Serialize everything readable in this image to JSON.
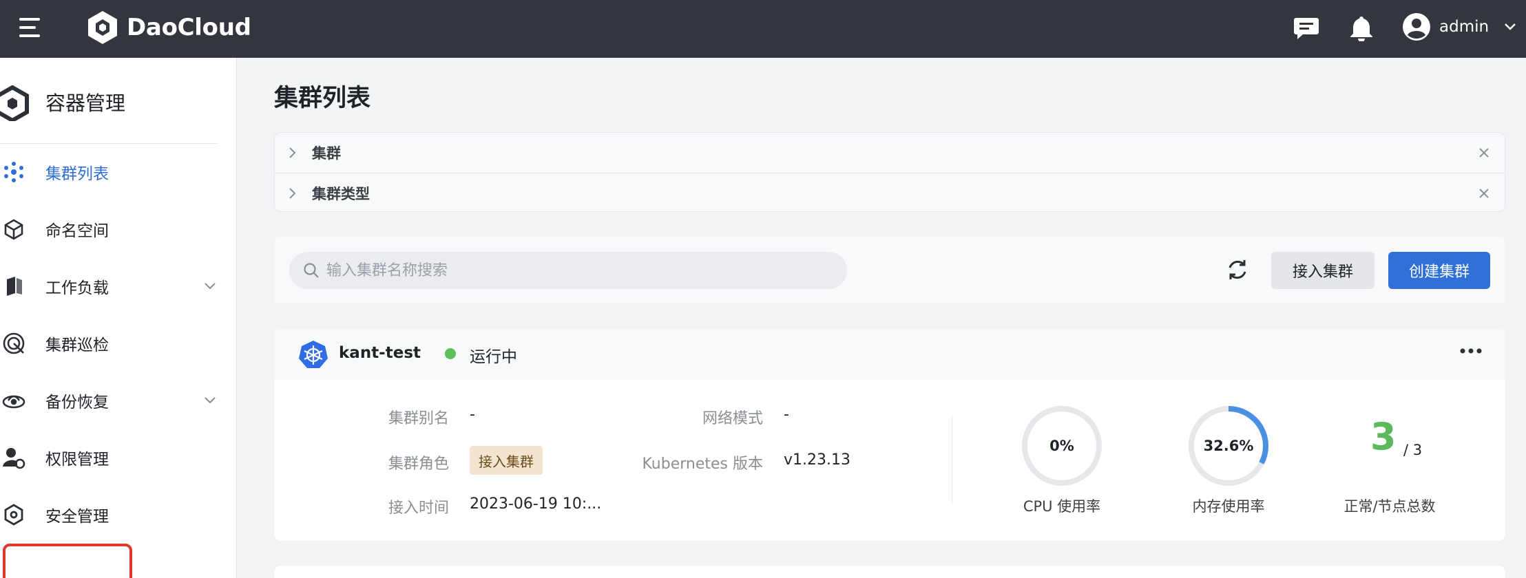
{
  "topbar": {
    "brand": "DaoCloud",
    "icons": [
      "hamburger-icon",
      "message-icon",
      "bell-icon",
      "user-avatar-icon",
      "chevron-down-icon"
    ],
    "username": "admin",
    "background": "#33363d"
  },
  "sidebar": {
    "title": "容器管理",
    "items": [
      {
        "label": "集群列表",
        "icon": "cluster-icon",
        "active": true
      },
      {
        "label": "命名空间",
        "icon": "namespace-icon"
      },
      {
        "label": "工作负载",
        "icon": "workload-icon",
        "expandable": true
      },
      {
        "label": "集群巡检",
        "icon": "inspection-icon"
      },
      {
        "label": "备份恢复",
        "icon": "backup-icon",
        "expandable": true
      },
      {
        "label": "权限管理",
        "icon": "permission-icon"
      },
      {
        "label": "安全管理",
        "icon": "security-icon",
        "highlighted": true
      }
    ]
  },
  "main": {
    "title": "集群列表",
    "filters": [
      "集群",
      "集群类型"
    ],
    "search": {
      "placeholder": "输入集群名称搜索",
      "value": ""
    },
    "buttons": {
      "connect": "接入集群",
      "create": "创建集群"
    },
    "cluster": {
      "name": "kant-test",
      "status": "运行中",
      "fields": {
        "alias_label": "集群别名",
        "alias_value": "-",
        "role_label": "集群角色",
        "role_value": "接入集群",
        "time_label": "接入时间",
        "time_value": "2023-06-19 10:...",
        "network_label": "网络模式",
        "network_value": "-",
        "k8s_label": "Kubernetes 版本",
        "k8s_value": "v1.23.13"
      },
      "metrics": {
        "cpu_value": "0%",
        "cpu_fraction": 0,
        "cpu_label": "CPU 使用率",
        "mem_value": "32.6%",
        "mem_fraction": 0.326,
        "mem_label": "内存使用率",
        "nodes_ok": "3",
        "nodes_total": "/ 3",
        "nodes_label": "正常/节点总数"
      }
    }
  },
  "colors": {
    "accent": "#2f6fd8",
    "status_ok": "#5ec05a",
    "highlight": "#e2372b",
    "gauge_track": "#e6e7eb",
    "gauge_fill": "#4a90e2"
  }
}
